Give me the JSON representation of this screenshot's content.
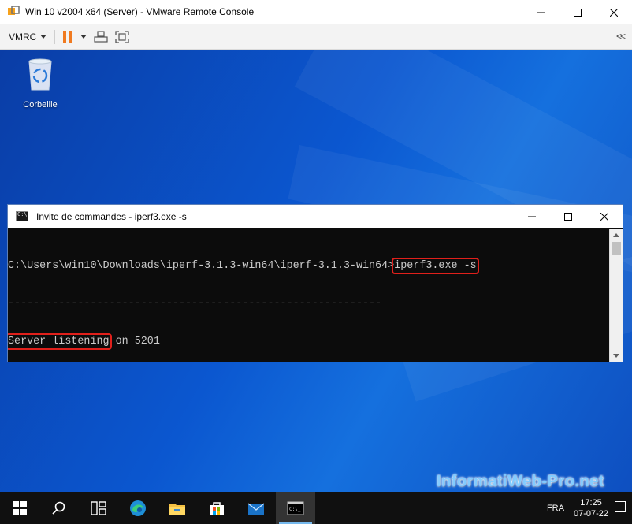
{
  "vmrc": {
    "window_title": "Win 10 v2004 x64 (Server) - VMware Remote Console",
    "menu_label": "VMRC",
    "icons": [
      "vmrc-logo-icon",
      "pause-icon",
      "send-ctrl-alt-del-icon",
      "fullscreen-icon",
      "collapse-icon"
    ],
    "accent_color": "#f07a20"
  },
  "desktop": {
    "recycle_bin_label": "Corbeille",
    "background_color": "#0b57d0"
  },
  "cmd": {
    "title": "Invite de commandes - iperf3.exe  -s",
    "lines": [
      {
        "prompt": "C:\\Users\\win10\\Downloads\\iperf-3.1.3-win64\\iperf-3.1.3-win64>",
        "command": "iperf3.exe -s"
      },
      {
        "text": "-----------------------------------------------------------"
      },
      {
        "highlight": "Server listening",
        "rest": " on 5201"
      },
      {
        "text": "-----------------------------------------------------------"
      }
    ],
    "highlight_color": "#e0201b"
  },
  "taskbar": {
    "items": [
      "start-icon",
      "search-icon",
      "task-view-icon",
      "edge-icon",
      "file-explorer-icon",
      "store-icon",
      "mail-icon",
      "cmd-icon"
    ],
    "language": "FRA",
    "time": "17:25",
    "date": "07-07-22"
  },
  "watermark": "InformatiWeb-Pro.net"
}
